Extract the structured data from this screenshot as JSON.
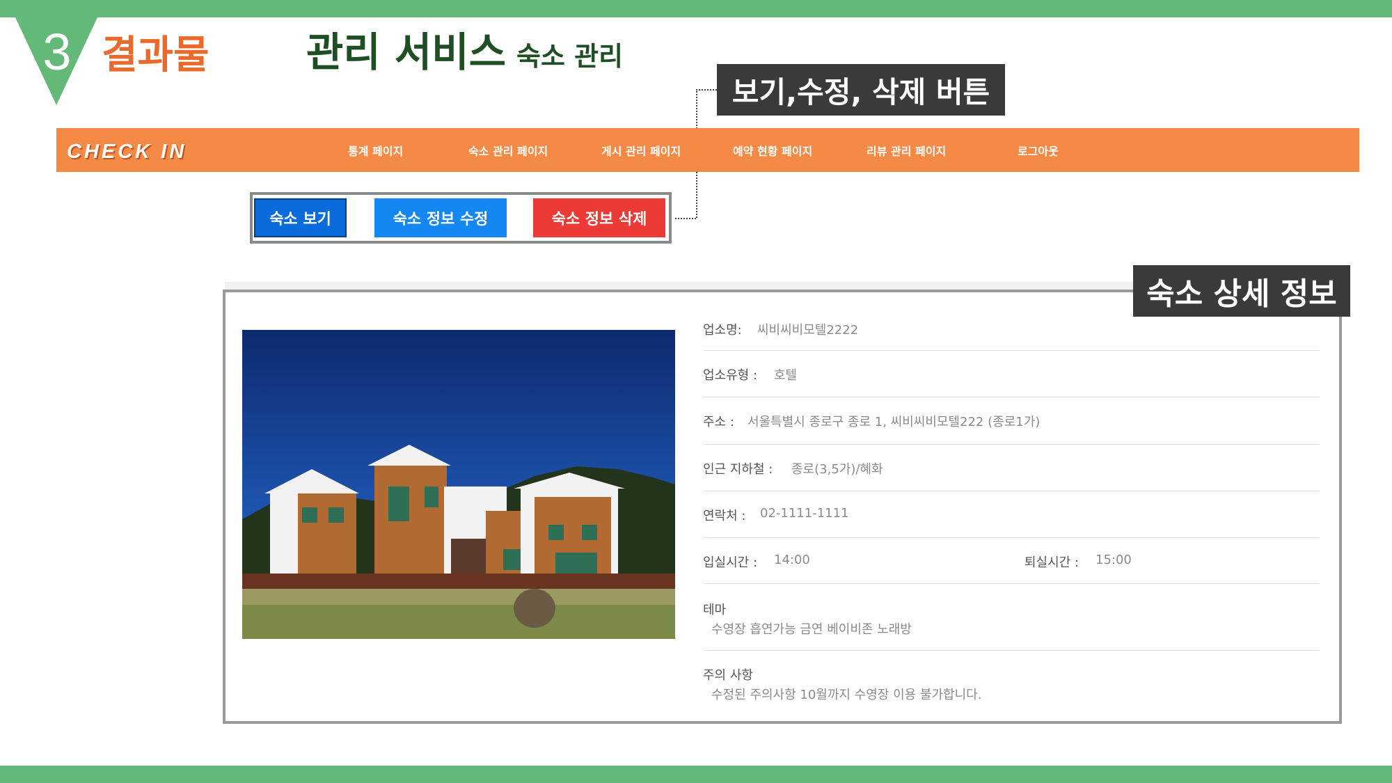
{
  "slide": {
    "section_number": "3",
    "section_title": "결과물",
    "title": "관리 서비스",
    "subtitle": "숙소 관리",
    "callout_buttons": "보기,수정, 삭제 버튼",
    "callout_detail": "숙소 상세 정보"
  },
  "colors": {
    "band_green": "#63b977",
    "nav_orange": "#f58a46",
    "view_button": "#0a6bdc",
    "edit_button": "#1487f2",
    "delete_button": "#ec3a36",
    "callout_bg": "#3a3a3a"
  },
  "nav": {
    "logo": "CHECK IN",
    "items": [
      "통계 페이지",
      "숙소 관리 페이지",
      "게시 관리 페이지",
      "예약 현황 페이지",
      "리뷰 관리 페이지",
      "로그아웃"
    ]
  },
  "buttons": {
    "view": "숙소 보기",
    "edit": "숙소 정보 수정",
    "delete": "숙소 정보 삭제"
  },
  "photo": {
    "icon": "lodging-photo"
  },
  "detail": {
    "name_label": "업소명:",
    "name_value": "씨비씨비모텔2222",
    "type_label": "업소유형 :",
    "type_value": "호텔",
    "address_label": "주소 :",
    "address_value": "서울특별시 종로구 종로 1, 씨비씨비모텔222 (종로1가)",
    "subway_label": "인근 지하철 :",
    "subway_value": "종로(3,5가)/혜화",
    "contact_label": "연락처 :",
    "contact_value": "02-1111-1111",
    "checkin_label": "입실시간 :",
    "checkin_value": "14:00",
    "checkout_label": "퇴실시간 :",
    "checkout_value": "15:00",
    "theme_label": "테마",
    "theme_value": "수영장 흡연가능 금연 베이비존 노래방",
    "notice_label": "주의 사항",
    "notice_value": "수정된 주의사항 10월까지 수영장 이용 불가합니다."
  }
}
